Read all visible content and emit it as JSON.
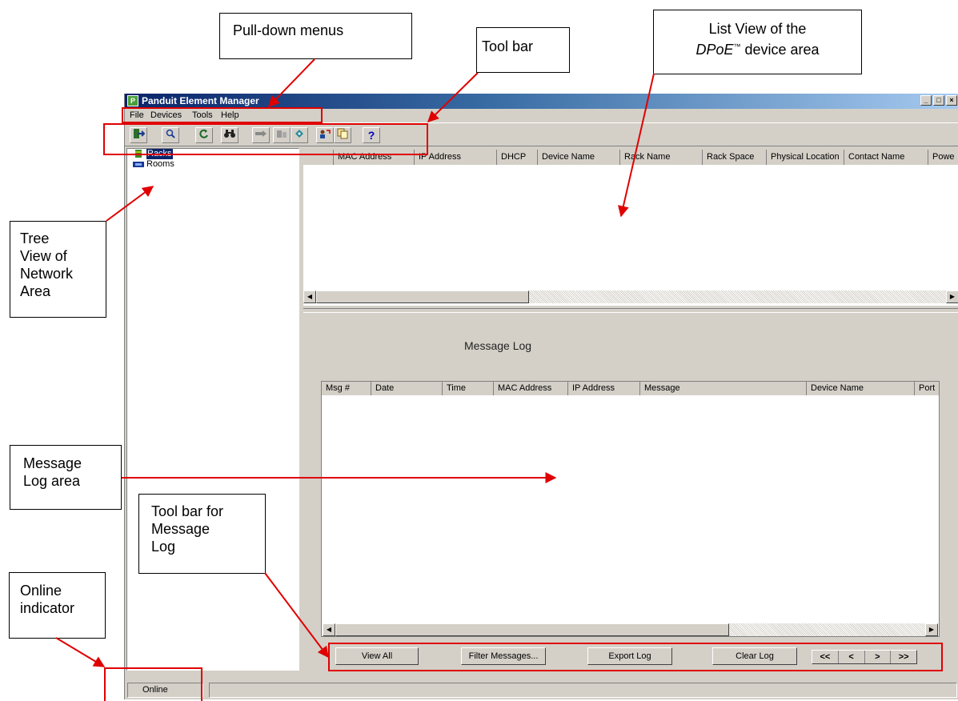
{
  "window": {
    "title": "Panduit Element Manager",
    "controls": [
      "_",
      "□",
      "×"
    ]
  },
  "menubar": [
    "File",
    "Devices",
    "Tools",
    "Help"
  ],
  "toolbar": {
    "buttons": [
      "exit-icon",
      "find-icon",
      "refresh-icon",
      "binoculars-icon",
      "connect-icon",
      "disconnect-icon",
      "tag-icon",
      "user-icon",
      "copy-icon",
      "help-icon"
    ],
    "help_glyph": "?"
  },
  "tree": {
    "items": [
      {
        "label": "Racks",
        "icon": "rack-icon",
        "selected": true
      },
      {
        "label": "Rooms",
        "icon": "room-icon",
        "selected": false
      }
    ]
  },
  "device_list": {
    "columns": [
      "MAC Address",
      "IP Address",
      "DHCP",
      "Device Name",
      "Rack Name",
      "Rack Space",
      "Physical Location",
      "Contact Name",
      "Powe"
    ]
  },
  "message_log": {
    "title": "Message Log",
    "columns": [
      "Msg #",
      "Date",
      "Time",
      "MAC Address",
      "IP Address",
      "Message",
      "Device Name",
      "Port"
    ],
    "buttons": {
      "view_all": "View All",
      "filter": "Filter Messages...",
      "export": "Export Log",
      "clear": "Clear Log"
    },
    "nav": [
      "<<",
      "<",
      ">",
      ">>"
    ]
  },
  "statusbar": {
    "online": "Online"
  },
  "callouts": {
    "pulldown": "Pull-down menus",
    "toolbar": "Tool bar",
    "listview_line1": "List View of the",
    "listview_line2_prefix": "DPoE",
    "listview_line2_tm": "™",
    "listview_line2_suffix": " device area",
    "tree_lines": [
      "Tree",
      "View of",
      "Network",
      "Area"
    ],
    "msglog_lines": [
      "Message",
      "Log area"
    ],
    "msgtoolbar_lines": [
      "Tool bar for",
      "Message",
      "Log"
    ],
    "online_lines": [
      "Online",
      "indicator"
    ]
  },
  "colors": {
    "annotation": "#e00000",
    "titlebar_start": "#0a246a",
    "titlebar_end": "#a6caf0",
    "window_face": "#d4d0c8"
  }
}
